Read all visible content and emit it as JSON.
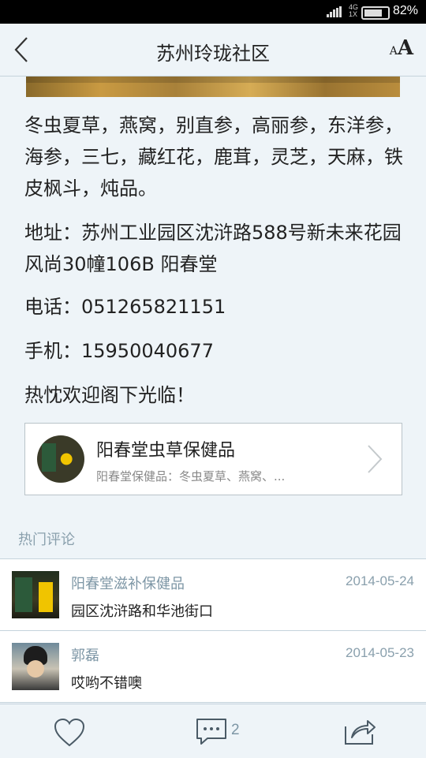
{
  "status_bar": {
    "net_top": "4G",
    "net_bottom": "1X",
    "battery_percent": "82%"
  },
  "header": {
    "title": "苏州玲珑社区",
    "font_small": "A",
    "font_large": "A"
  },
  "article": {
    "products": "冬虫夏草，燕窝，别直参，高丽参，东洋参，海参，三七，藏红花，鹿茸，灵芝，天麻，铁皮枫斗，炖品。",
    "address": "地址：苏州工业园区沈浒路588号新未来花园风尚30幢106B 阳春堂",
    "phone": "电话：051265821151",
    "mobile": "手机：15950040677",
    "welcome": "热忱欢迎阁下光临！"
  },
  "shop_card": {
    "name": "阳春堂虫草保健品",
    "description": "阳春堂保健品：冬虫夏草、燕窝、..."
  },
  "comments_section": {
    "title": "热门评论",
    "items": [
      {
        "author": "阳春堂滋补保健品",
        "date": "2014-05-24",
        "text": "园区沈浒路和华池街口"
      },
      {
        "author": "郭磊",
        "date": "2014-05-23",
        "text": "哎哟不错噢"
      }
    ]
  },
  "bottom_bar": {
    "comment_count": "2"
  }
}
